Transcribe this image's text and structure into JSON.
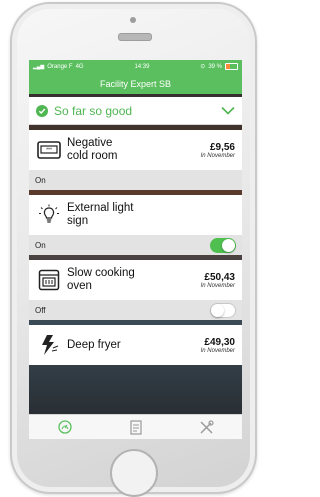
{
  "status_bar": {
    "carrier": "Orange F",
    "network": "4G",
    "time": "14:39",
    "battery": "39 %",
    "battery_level": 0.39
  },
  "nav": {
    "title": "Facility Expert SB"
  },
  "summary": {
    "status": "So far so good"
  },
  "items": [
    {
      "name_line1": "Negative",
      "name_line2": "cold room",
      "price": "£9,56",
      "period": "In November",
      "state": "On",
      "has_toggle": false,
      "icon": "fridge-icon"
    },
    {
      "name_line1": "External light",
      "name_line2": "sign",
      "price": "",
      "period": "",
      "state": "On",
      "has_toggle": true,
      "toggle_on": true,
      "icon": "light-bulb-icon"
    },
    {
      "name_line1": "Slow cooking",
      "name_line2": "oven",
      "price": "£50,43",
      "period": "In November",
      "state": "Off",
      "has_toggle": true,
      "toggle_on": false,
      "icon": "oven-icon"
    },
    {
      "name_line1": "Deep fryer",
      "name_line2": "",
      "price": "£49,30",
      "period": "In November",
      "state": "",
      "has_toggle": false,
      "icon": "lightning-icon"
    }
  ],
  "tabs": [
    {
      "icon": "gauge-icon",
      "active": true
    },
    {
      "icon": "report-icon",
      "active": false
    },
    {
      "icon": "tools-icon",
      "active": false
    }
  ],
  "colors": {
    "accent": "#5bbf5f",
    "status_green": "#4fb652"
  }
}
